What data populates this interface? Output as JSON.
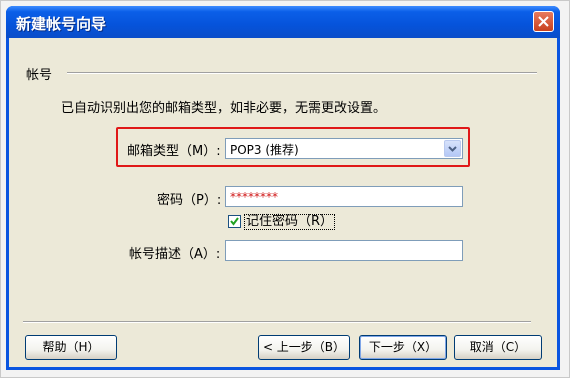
{
  "window": {
    "title": "新建帐号向导"
  },
  "section": {
    "label": "帐号"
  },
  "description": "已自动识别出您的邮箱类型，如非必要，无需更改设置。",
  "mailbox_type": {
    "label": "邮箱类型（M）:",
    "value": "POP3 (推荐)"
  },
  "password": {
    "label": "密码（P）:",
    "value": "********"
  },
  "remember": {
    "label": "记住密码（R）",
    "checked": true
  },
  "account_desc": {
    "label": "帐号描述（A）:",
    "value": ""
  },
  "buttons": {
    "help": "帮助（H）",
    "back": "< 上一步（B）",
    "next": "下一步（X）",
    "cancel": "取消（C）"
  },
  "colors": {
    "highlight_box": "#e01818",
    "titlebar": "#0653da"
  }
}
